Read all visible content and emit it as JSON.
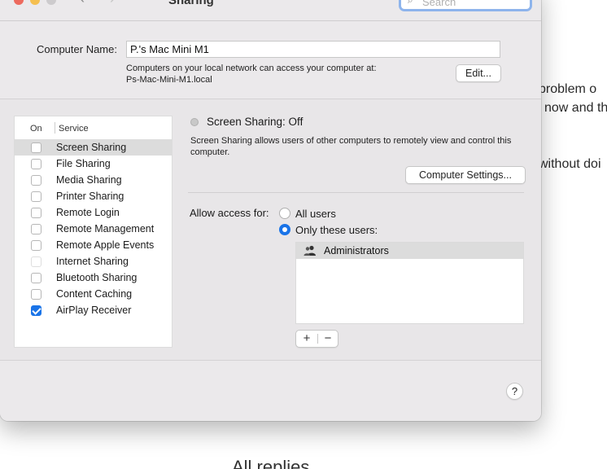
{
  "background": {
    "text_line_1": "problem o",
    "text_line_2": "now and th",
    "text_line_3": "without doi",
    "footer_heading": "All replies"
  },
  "window": {
    "title": "Sharing",
    "nav_back": "‹",
    "nav_forward": "›",
    "grid_icon": "⋯⋯",
    "search_placeholder": "Search"
  },
  "computer": {
    "name_label": "Computer Name:",
    "name_value": "P.'s Mac Mini M1",
    "info_line_1": "Computers on your local network can access your computer at:",
    "info_line_2": "Ps-Mac-Mini-M1.local",
    "edit_label": "Edit..."
  },
  "services": {
    "header_on": "On",
    "header_service": "Service",
    "items": [
      {
        "label": "Screen Sharing",
        "checked": false,
        "selected": true
      },
      {
        "label": "File Sharing",
        "checked": false
      },
      {
        "label": "Media Sharing",
        "checked": false
      },
      {
        "label": "Printer Sharing",
        "checked": false
      },
      {
        "label": "Remote Login",
        "checked": false
      },
      {
        "label": "Remote Management",
        "checked": false
      },
      {
        "label": "Remote Apple Events",
        "checked": false
      },
      {
        "label": "Internet Sharing",
        "checked": false,
        "disabled": true
      },
      {
        "label": "Bluetooth Sharing",
        "checked": false
      },
      {
        "label": "Content Caching",
        "checked": false
      },
      {
        "label": "AirPlay Receiver",
        "checked": true
      }
    ]
  },
  "detail": {
    "status": "Screen Sharing: Off",
    "description": "Screen Sharing allows users of other computers to remotely view and control this computer.",
    "settings_button": "Computer Settings...",
    "access_label": "Allow access for:",
    "option_all": "All users",
    "option_only": "Only these users:",
    "selected_option": "only",
    "users": [
      "Administrators"
    ],
    "add_label": "+",
    "remove_label": "−"
  },
  "help_label": "?",
  "colors": {
    "accent": "#1a74e8",
    "close": "#ed6a5e",
    "minimize": "#f5bf4f",
    "zoom_inactive": "#cdcbcd"
  }
}
